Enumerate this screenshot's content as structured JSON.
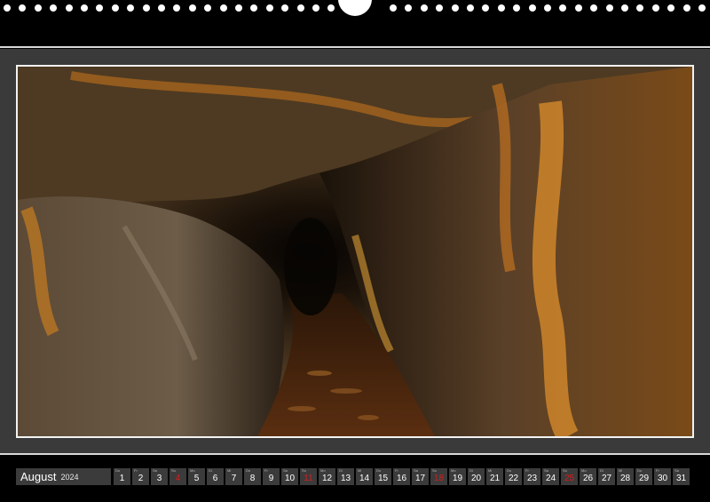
{
  "calendar": {
    "month": "August",
    "year": "2024",
    "days": [
      {
        "wd": "Do",
        "num": "1",
        "sunday": false
      },
      {
        "wd": "Fr",
        "num": "2",
        "sunday": false
      },
      {
        "wd": "Sa",
        "num": "3",
        "sunday": false
      },
      {
        "wd": "So",
        "num": "4",
        "sunday": true
      },
      {
        "wd": "Mo",
        "num": "5",
        "sunday": false
      },
      {
        "wd": "Di",
        "num": "6",
        "sunday": false
      },
      {
        "wd": "Mi",
        "num": "7",
        "sunday": false
      },
      {
        "wd": "Do",
        "num": "8",
        "sunday": false
      },
      {
        "wd": "Fr",
        "num": "9",
        "sunday": false
      },
      {
        "wd": "Sa",
        "num": "10",
        "sunday": false
      },
      {
        "wd": "So",
        "num": "11",
        "sunday": true
      },
      {
        "wd": "Mo",
        "num": "12",
        "sunday": false
      },
      {
        "wd": "Di",
        "num": "13",
        "sunday": false
      },
      {
        "wd": "Mi",
        "num": "14",
        "sunday": false
      },
      {
        "wd": "Do",
        "num": "15",
        "sunday": false
      },
      {
        "wd": "Fr",
        "num": "16",
        "sunday": false
      },
      {
        "wd": "Sa",
        "num": "17",
        "sunday": false
      },
      {
        "wd": "So",
        "num": "18",
        "sunday": true
      },
      {
        "wd": "Mo",
        "num": "19",
        "sunday": false
      },
      {
        "wd": "Di",
        "num": "20",
        "sunday": false
      },
      {
        "wd": "Mi",
        "num": "21",
        "sunday": false
      },
      {
        "wd": "Do",
        "num": "22",
        "sunday": false
      },
      {
        "wd": "Fr",
        "num": "23",
        "sunday": false
      },
      {
        "wd": "Sa",
        "num": "24",
        "sunday": false
      },
      {
        "wd": "So",
        "num": "25",
        "sunday": true
      },
      {
        "wd": "Mo",
        "num": "26",
        "sunday": false
      },
      {
        "wd": "Di",
        "num": "27",
        "sunday": false
      },
      {
        "wd": "Mi",
        "num": "28",
        "sunday": false
      },
      {
        "wd": "Do",
        "num": "29",
        "sunday": false
      },
      {
        "wd": "Fr",
        "num": "30",
        "sunday": false
      },
      {
        "wd": "Sa",
        "num": "31",
        "sunday": false
      }
    ]
  },
  "colors": {
    "sunday": "#d21f1f",
    "cell": "#3b3b3b",
    "panel": "#3a3a3a",
    "frame": "#f2f2f2"
  }
}
